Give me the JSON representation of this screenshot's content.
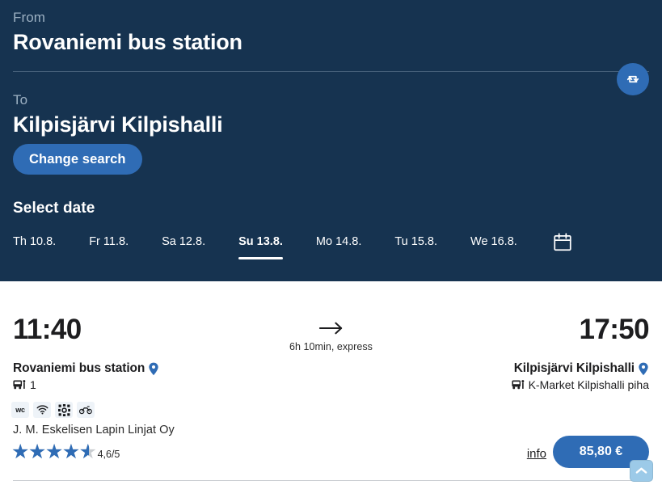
{
  "search": {
    "from_label": "From",
    "from_value": "Rovaniemi bus station",
    "to_label": "To",
    "to_value": "Kilpisjärvi Kilpishalli",
    "change_search_label": "Change search",
    "swap_icon": "swap-arrows-icon",
    "select_date_label": "Select date",
    "calendar_icon": "calendar-icon",
    "dates": [
      {
        "label": "Th 10.8.",
        "selected": false
      },
      {
        "label": "Fr 11.8.",
        "selected": false
      },
      {
        "label": "Sa 12.8.",
        "selected": false
      },
      {
        "label": "Su 13.8.",
        "selected": true
      },
      {
        "label": "Mo 14.8.",
        "selected": false
      },
      {
        "label": "Tu 15.8.",
        "selected": false
      },
      {
        "label": "We 16.8.",
        "selected": false
      }
    ]
  },
  "result": {
    "departure_time": "11:40",
    "arrival_time": "17:50",
    "arrow_icon": "arrow-right-icon",
    "duration": "6h 10min, express",
    "origin_name": "Rovaniemi bus station",
    "origin_pin_icon": "location-pin-icon",
    "origin_bus_icon": "bus-stop-icon",
    "origin_platform": "1",
    "destination_name": "Kilpisjärvi Kilpishalli",
    "destination_pin_icon": "location-pin-icon",
    "destination_bus_icon": "bus-stop-icon",
    "destination_platform": "K-Market Kilpishalli piha",
    "amenities": [
      {
        "name": "wc-icon",
        "text": "wc"
      },
      {
        "name": "wifi-icon",
        "text": ""
      },
      {
        "name": "air-conditioning-icon",
        "text": ""
      },
      {
        "name": "bicycle-icon",
        "text": ""
      }
    ],
    "operator": "J. M. Eskelisen Lapin Linjat Oy",
    "rating_value": "4,6/5",
    "rating_fraction": 92,
    "info_label": "info",
    "price_label": "85,80 €"
  },
  "scroll_top": {
    "icon": "chevron-up-icon"
  },
  "colors": {
    "header_bg": "#163350",
    "accent_blue": "#2f6cb5",
    "muted_label": "#9cb0c2",
    "star_blue": "#2f6cb5",
    "scroll_top_bg": "#9ccae8"
  }
}
